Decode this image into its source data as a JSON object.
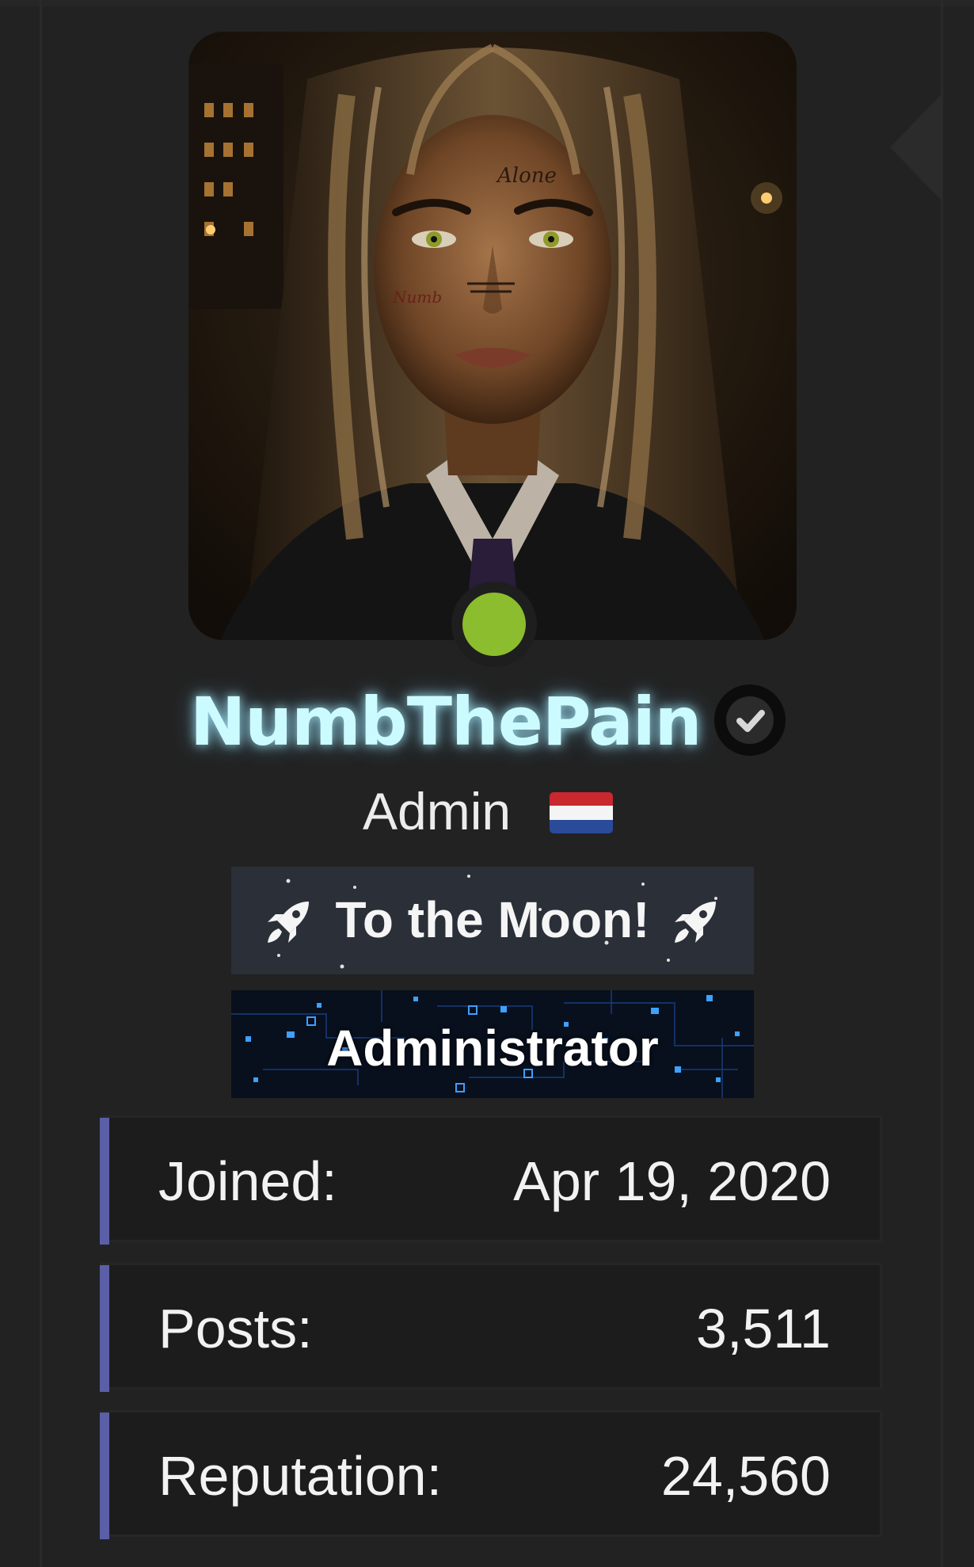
{
  "profile": {
    "username": "NumbThePain",
    "role": "Admin",
    "verified_icon": "check-circle-icon",
    "flag_icon": "netherlands-flag-icon",
    "online_status_icon": "online-dot-icon",
    "avatar_tattoo_forehead": "Alone",
    "avatar_tattoo_cheek": "Numb"
  },
  "banners": {
    "moon_label": "To the Moon!",
    "moon_icon": "rocket-icon",
    "group_label": "Administrator"
  },
  "stats": [
    {
      "label": "Joined:",
      "value": "Apr 19, 2020"
    },
    {
      "label": "Posts:",
      "value": "3,511"
    },
    {
      "label": "Reputation:",
      "value": "24,560"
    }
  ],
  "colors": {
    "page_bg": "#222222",
    "username_glow": "#ccfbff",
    "online": "#8bbd2e",
    "stat_accent": "#5a5fa8",
    "moon_banner_bg": "#2a2f38",
    "admin_banner_bg": "#08101e"
  }
}
